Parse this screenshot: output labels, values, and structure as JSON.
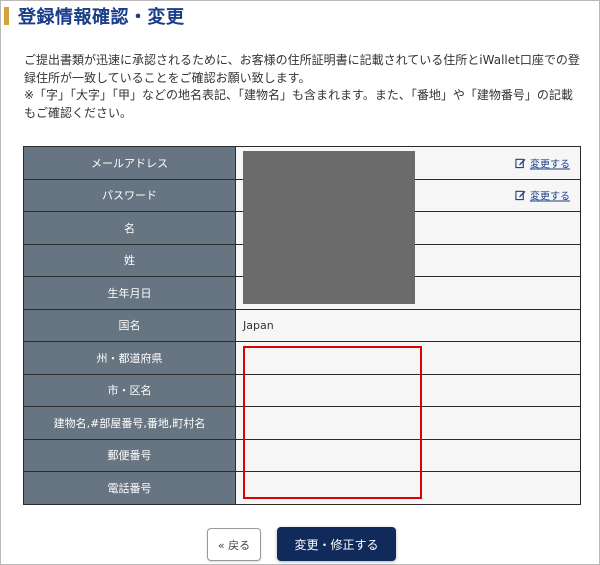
{
  "page": {
    "title": "登録情報確認・変更"
  },
  "notice": {
    "line1": "ご提出書類が迅速に承認されるために、お客様の住所証明書に記載されている住所とiWallet口座での登録住所が一致していることをご確認お願い致します。",
    "line2": "※「字」「大字」「甲」などの地名表記、「建物名」も含まれます。また、「番地」や「建物番号」の記載もご確認ください。"
  },
  "table": {
    "rows": [
      {
        "label": "メールアドレス",
        "value": "",
        "link": "変更する"
      },
      {
        "label": "パスワード",
        "value": "",
        "link": "変更する"
      },
      {
        "label": "名",
        "value": ""
      },
      {
        "label": "姓",
        "value": ""
      },
      {
        "label": "生年月日",
        "value": ""
      },
      {
        "label": "国名",
        "value": "Japan"
      },
      {
        "label": "州・都道府県",
        "value": ""
      },
      {
        "label": "市・区名",
        "value": ""
      },
      {
        "label": "建物名,#部屋番号,番地,町村名",
        "value": ""
      },
      {
        "label": "郵便番号",
        "value": ""
      },
      {
        "label": "電話番号",
        "value": ""
      }
    ]
  },
  "buttons": {
    "back_label": "« 戻る",
    "submit_label": "変更・修正する"
  },
  "colors": {
    "accent": "#d4a23a",
    "title": "#1a3e8a",
    "label_bg": "#677481",
    "submit_bg": "#102a5c",
    "highlight": "#e00000"
  },
  "icons": {
    "edit": "edit-icon"
  }
}
